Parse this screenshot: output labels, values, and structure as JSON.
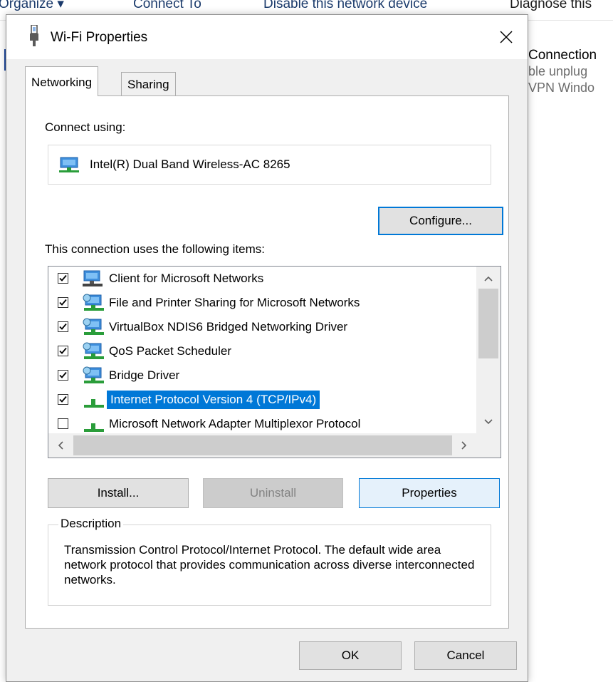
{
  "background": {
    "toolbar": [
      "Organize ▾",
      "Connect To",
      "Disable this network device",
      "Diagnose this"
    ],
    "right_text": [
      "Connection",
      "ble unplug",
      "VPN Windo"
    ]
  },
  "dialog": {
    "title": "Wi-Fi Properties",
    "tabs": [
      {
        "label": "Networking",
        "active": true
      },
      {
        "label": "Sharing",
        "active": false
      }
    ],
    "connect_using_label": "Connect using:",
    "adapter_name": "Intel(R) Dual Band Wireless-AC 8265",
    "configure_label": "Configure...",
    "items_label": "This connection uses the following items:",
    "items": [
      {
        "label": "Client for Microsoft Networks",
        "checked": true,
        "icon": "network-client-icon"
      },
      {
        "label": "File and Printer Sharing for Microsoft Networks",
        "checked": true,
        "icon": "network-service-icon"
      },
      {
        "label": "VirtualBox NDIS6 Bridged Networking Driver",
        "checked": true,
        "icon": "network-service-icon"
      },
      {
        "label": "QoS Packet Scheduler",
        "checked": true,
        "icon": "network-service-icon"
      },
      {
        "label": "Bridge Driver",
        "checked": true,
        "icon": "network-service-icon"
      },
      {
        "label": "Internet Protocol Version 4 (TCP/IPv4)",
        "checked": true,
        "selected": true,
        "icon": "network-protocol-icon"
      },
      {
        "label": "Microsoft Network Adapter Multiplexor Protocol",
        "checked": false,
        "icon": "network-protocol-icon"
      }
    ],
    "install_label": "Install...",
    "uninstall_label": "Uninstall",
    "properties_label": "Properties",
    "description_legend": "Description",
    "description_text": "Transmission Control Protocol/Internet Protocol. The default wide area network protocol that provides communication across diverse interconnected networks.",
    "ok_label": "OK",
    "cancel_label": "Cancel"
  },
  "colors": {
    "accent": "#0078d7",
    "dialog_bg": "#f0f0f0",
    "panel_bg": "#ffffff"
  }
}
